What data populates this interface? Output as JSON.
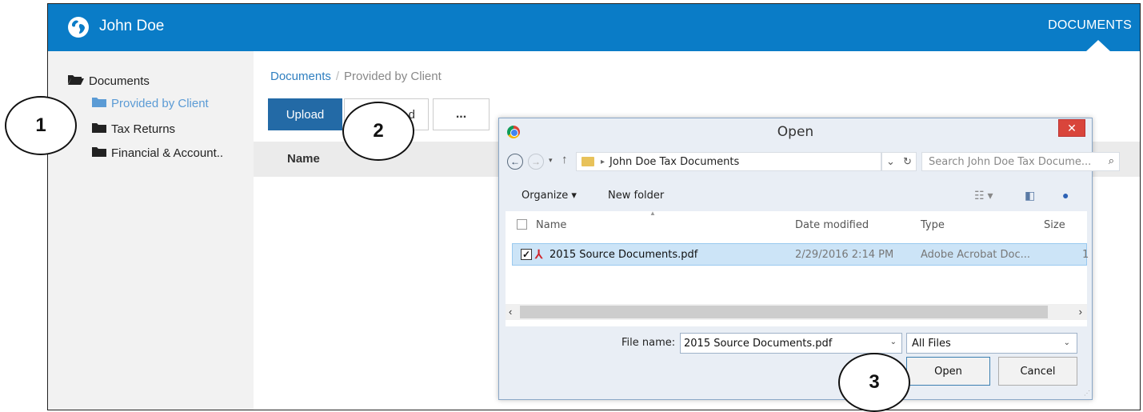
{
  "header": {
    "user_name": "John Doe",
    "nav_documents": "DOCUMENTS",
    "brand_color": "#0a7cc7"
  },
  "sidebar": {
    "root_label": "Documents",
    "items": [
      {
        "label": "Provided by Client",
        "active": true
      },
      {
        "label": "Tax Returns",
        "active": false
      },
      {
        "label": "Financial & Account..",
        "active": false
      }
    ]
  },
  "main": {
    "breadcrumb_root": "Documents",
    "breadcrumb_separator": "/",
    "breadcrumb_current": "Provided by Client",
    "upload_label": "Upload",
    "second_button_label": "d",
    "more_label": "...",
    "column_name": "Name"
  },
  "dialog": {
    "title": "Open",
    "close_label": "✕",
    "address_path": "John Doe Tax  Documents",
    "search_placeholder": "Search John Doe Tax  Docume...",
    "organize_label": "Organize ▾",
    "new_folder_label": "New folder",
    "columns": {
      "name": "Name",
      "date_modified": "Date modified",
      "type": "Type",
      "size": "Size"
    },
    "files": [
      {
        "name": "2015 Source Documents.pdf",
        "date_modified": "2/29/2016 2:14 PM",
        "type": "Adobe Acrobat Doc...",
        "size_partial": "1",
        "checked": true
      }
    ],
    "file_name_label": "File name:",
    "file_name_value": "2015 Source Documents.pdf",
    "file_type_value": "All Files",
    "open_label": "Open",
    "cancel_label": "Cancel"
  },
  "callouts": [
    "1",
    "2",
    "3"
  ]
}
